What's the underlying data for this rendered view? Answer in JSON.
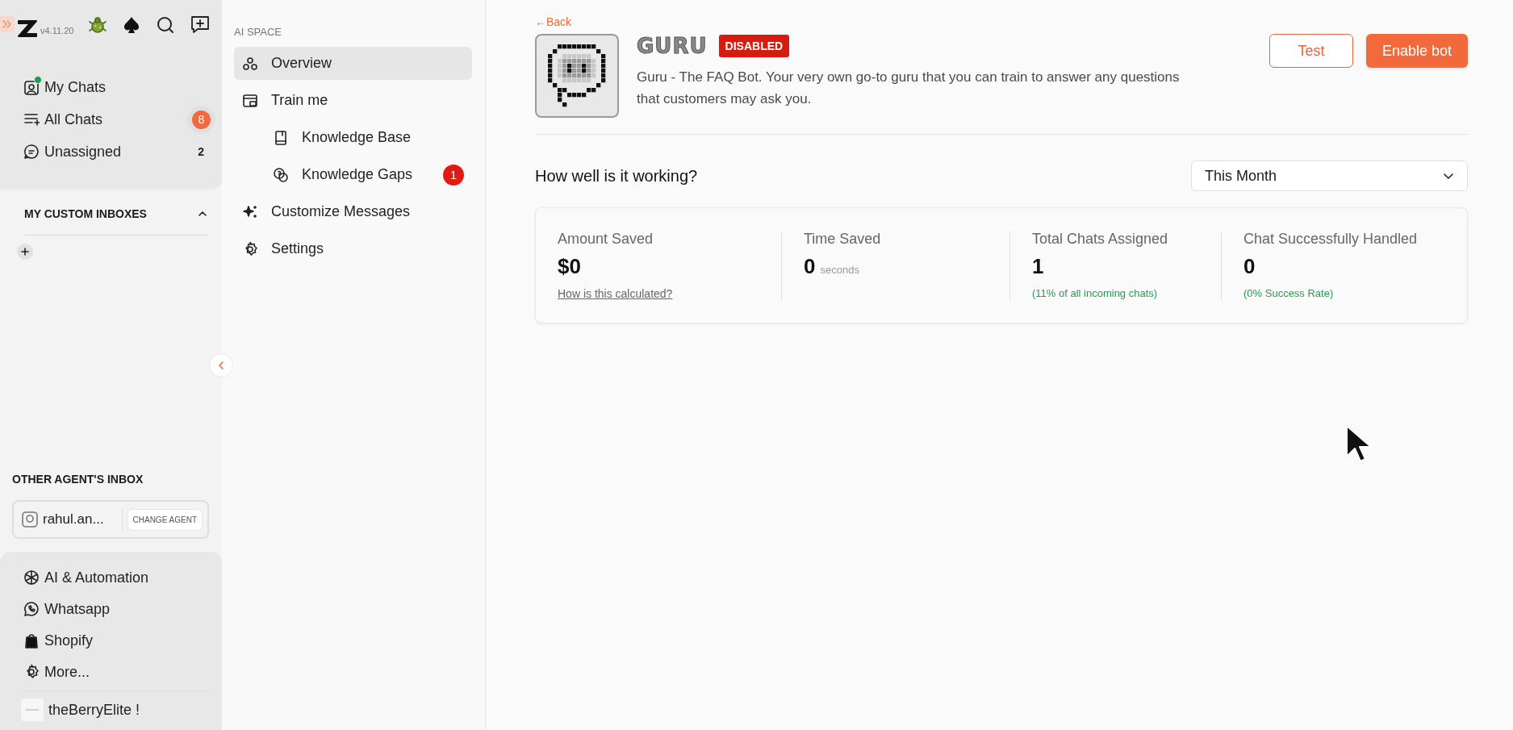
{
  "sidebar": {
    "version": "v4.11.20",
    "nav": [
      {
        "label": "My Chats",
        "online": true,
        "selected": false
      },
      {
        "label": "All Chats",
        "count": {
          "text": "8",
          "kind": "pill"
        },
        "selected": false
      },
      {
        "label": "Unassigned",
        "count": {
          "text": "2",
          "kind": "plain"
        },
        "selected": false
      }
    ],
    "custom_inboxes": {
      "title": "MY CUSTOM INBOXES",
      "expanded": true
    },
    "other_agent": {
      "title": "OTHER AGENT'S INBOX",
      "agent": "rahul.an...",
      "button": "CHANGE AGENT"
    },
    "bottom_items": [
      {
        "label": "AI & Automation"
      },
      {
        "label": "Whatsapp"
      },
      {
        "label": "Shopify"
      },
      {
        "label": "More..."
      }
    ],
    "workspace": "theBerryElite !"
  },
  "ai_nav": {
    "title": "AI SPACE",
    "items": [
      {
        "label": "Overview",
        "selected": true
      },
      {
        "label": "Train me",
        "selected": false,
        "children": [
          {
            "label": "Knowledge Base",
            "selected": false
          },
          {
            "label": "Knowledge Gaps",
            "selected": false,
            "badge": "1"
          }
        ]
      },
      {
        "label": "Customize Messages",
        "selected": false
      },
      {
        "label": "Settings",
        "selected": false
      }
    ]
  },
  "main": {
    "back": "←Back",
    "bot": {
      "name": "GURU",
      "status": "DISABLED",
      "description": "Guru - The FAQ Bot. Your very own go-to guru that you can train to answer any questions that customers may ask you."
    },
    "buttons": [
      {
        "label": "Test",
        "kind": "outline"
      },
      {
        "label": "Enable bot",
        "kind": "primary"
      }
    ],
    "section_title": "How well is it working?",
    "period": "This Month",
    "stats": [
      {
        "label": "Amount Saved",
        "value": "$0",
        "link": "How is this calculated?"
      },
      {
        "label": "Time Saved",
        "value": "0",
        "unit": "seconds"
      },
      {
        "label": "Total Chats Assigned",
        "value": "1",
        "note": "(11% of all incoming chats)"
      },
      {
        "label": "Chat Successfully Handled",
        "value": "0",
        "note": "(0% Success Rate)"
      }
    ]
  }
}
